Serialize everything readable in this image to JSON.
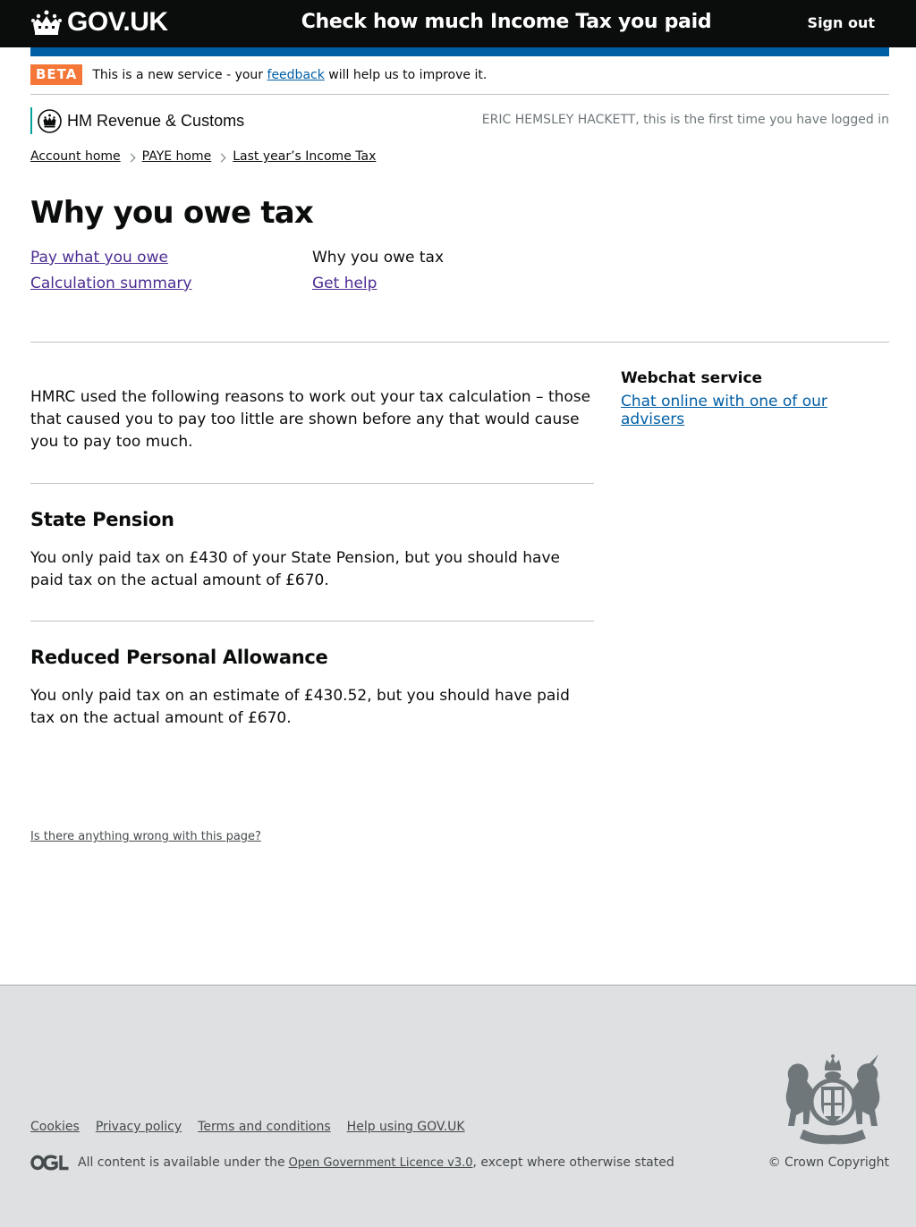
{
  "header": {
    "logo_text": "GOV.UK",
    "service_name": "Check how much Income Tax you paid",
    "sign_out": "Sign out"
  },
  "beta": {
    "tag": "BETA",
    "text_before": "This is a new service - your",
    "link": "feedback",
    "text_after": "will help us to improve it."
  },
  "org": {
    "name": "HM Revenue & Customs",
    "logged_in": "ERIC HEMSLEY HACKETT, this is the first time you have logged in"
  },
  "breadcrumbs": [
    "Account home",
    "PAYE home",
    "Last year’s Income Tax"
  ],
  "page_title": "Why you owe tax",
  "subnav": {
    "pay": "Pay what you owe",
    "summary": "Calculation summary",
    "why": "Why you owe tax",
    "help": "Get help"
  },
  "intro": "HMRC used the following reasons to work out your tax calculation – those that caused you to pay too little are shown before any that would cause you to pay too much.",
  "sections": [
    {
      "title": "State Pension",
      "body": "You only paid tax on £430 of your State Pension, but you should have paid tax on the actual amount of £670."
    },
    {
      "title": "Reduced Personal Allowance",
      "body": "You only paid tax on an estimate of £430.52, but you should have paid tax on the actual amount of £670."
    }
  ],
  "sidebar": {
    "title": "Webchat service",
    "link": "Chat online with one of our advisers"
  },
  "wrong_page": "Is there anything wrong with this page?",
  "footer": {
    "links": [
      "Cookies",
      "Privacy policy",
      "Terms and conditions",
      "Help using GOV.UK"
    ],
    "licence_before": "All content is available under the",
    "licence_link": "Open Government Licence v3.0",
    "licence_after": ", except where otherwise stated",
    "copyright": "© Crown Copyright"
  },
  "colors": {
    "header_bg": "#0b0c0c",
    "blue_bar": "#005ea5",
    "beta_tag": "#f47738",
    "hmrc_accent": "#00a19b",
    "footer_bg": "#dee0e2",
    "link_visited": "#4c2c92",
    "link": "#005ea5"
  }
}
